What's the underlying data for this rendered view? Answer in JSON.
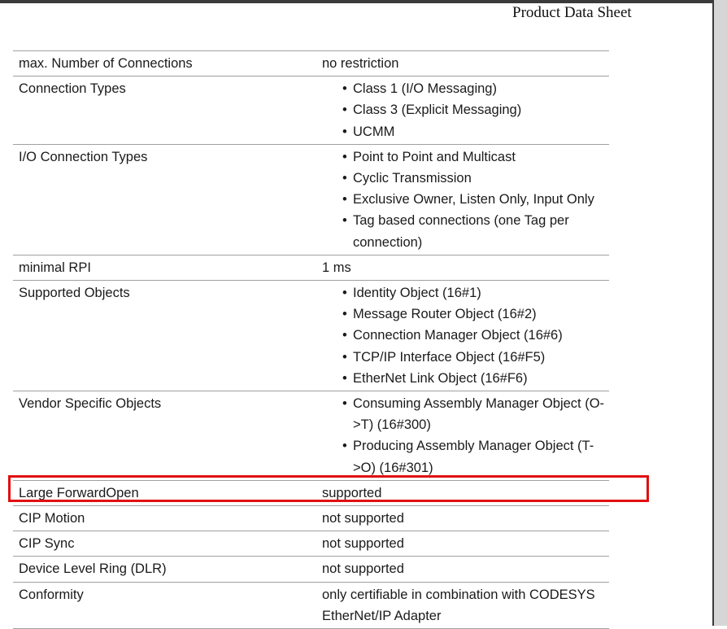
{
  "header": {
    "title": "Product Data Sheet"
  },
  "rows": [
    {
      "label": "max. Number of Connections",
      "value": "no restriction"
    },
    {
      "label": "Connection Types",
      "items": [
        "Class 1 (I/O Messaging)",
        "Class 3 (Explicit Messaging)",
        "UCMM"
      ]
    },
    {
      "label": "I/O Connection Types",
      "items": [
        "Point to Point and Multicast",
        "Cyclic Transmission",
        "Exclusive Owner, Listen Only, Input Only",
        "Tag based connections (one Tag per connection)"
      ]
    },
    {
      "label": "minimal RPI",
      "value": "1 ms"
    },
    {
      "label": "Supported Objects",
      "items": [
        "Identity Object (16#1)",
        "Message Router Object (16#2)",
        "Connection Manager Object (16#6)",
        "TCP/IP Interface Object (16#F5)",
        "EtherNet Link Object (16#F6)"
      ]
    },
    {
      "label": "Vendor Specific Objects",
      "items": [
        "Consuming Assembly Manager Object (O->T) (16#300)",
        "Producing Assembly Manager Object (T->O) (16#301)"
      ]
    },
    {
      "label": "Large ForwardOpen",
      "value": "supported"
    },
    {
      "label": "CIP Motion",
      "value": "not supported"
    },
    {
      "label": "CIP Sync",
      "value": "not supported"
    },
    {
      "label": "Device Level Ring (DLR)",
      "value": "not supported"
    },
    {
      "label": "Conformity",
      "value": "only certifiable in combination with CODESYS EtherNet/IP Adapter"
    }
  ],
  "colors": {
    "highlight": "#e01010",
    "rule": "#a0a0a0"
  }
}
